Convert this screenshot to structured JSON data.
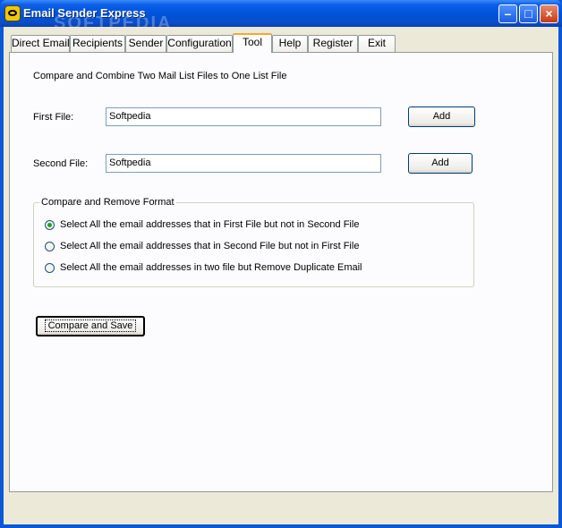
{
  "window": {
    "title": "Email Sender Express",
    "watermark": "SOFTPEDIA"
  },
  "tabs": [
    {
      "label": "Direct Email"
    },
    {
      "label": "Recipients"
    },
    {
      "label": "Sender"
    },
    {
      "label": "Configuration"
    },
    {
      "label": "Tool",
      "active": true
    },
    {
      "label": "Help"
    },
    {
      "label": "Register"
    },
    {
      "label": "Exit"
    }
  ],
  "tool": {
    "heading": "Compare and Combine Two Mail List Files to  One List File",
    "first_file": {
      "label": "First File:",
      "value": "Softpedia",
      "button": "Add"
    },
    "second_file": {
      "label": "Second File:",
      "value": "Softpedia",
      "button": "Add"
    },
    "group": {
      "title": "Compare and Remove Format",
      "options": [
        {
          "label": "Select All the email addresses that in First File but not in Second File",
          "selected": true
        },
        {
          "label": "Select All the email addresses that in Second File but not in First File",
          "selected": false
        },
        {
          "label": "Select All the email addresses in two file but Remove Duplicate Email",
          "selected": false
        }
      ]
    },
    "compare_button": "Compare and Save"
  },
  "colors": {
    "titlebar": "#0052d8",
    "tab_highlight": "#f8a830",
    "radio_dot": "#21a121"
  }
}
